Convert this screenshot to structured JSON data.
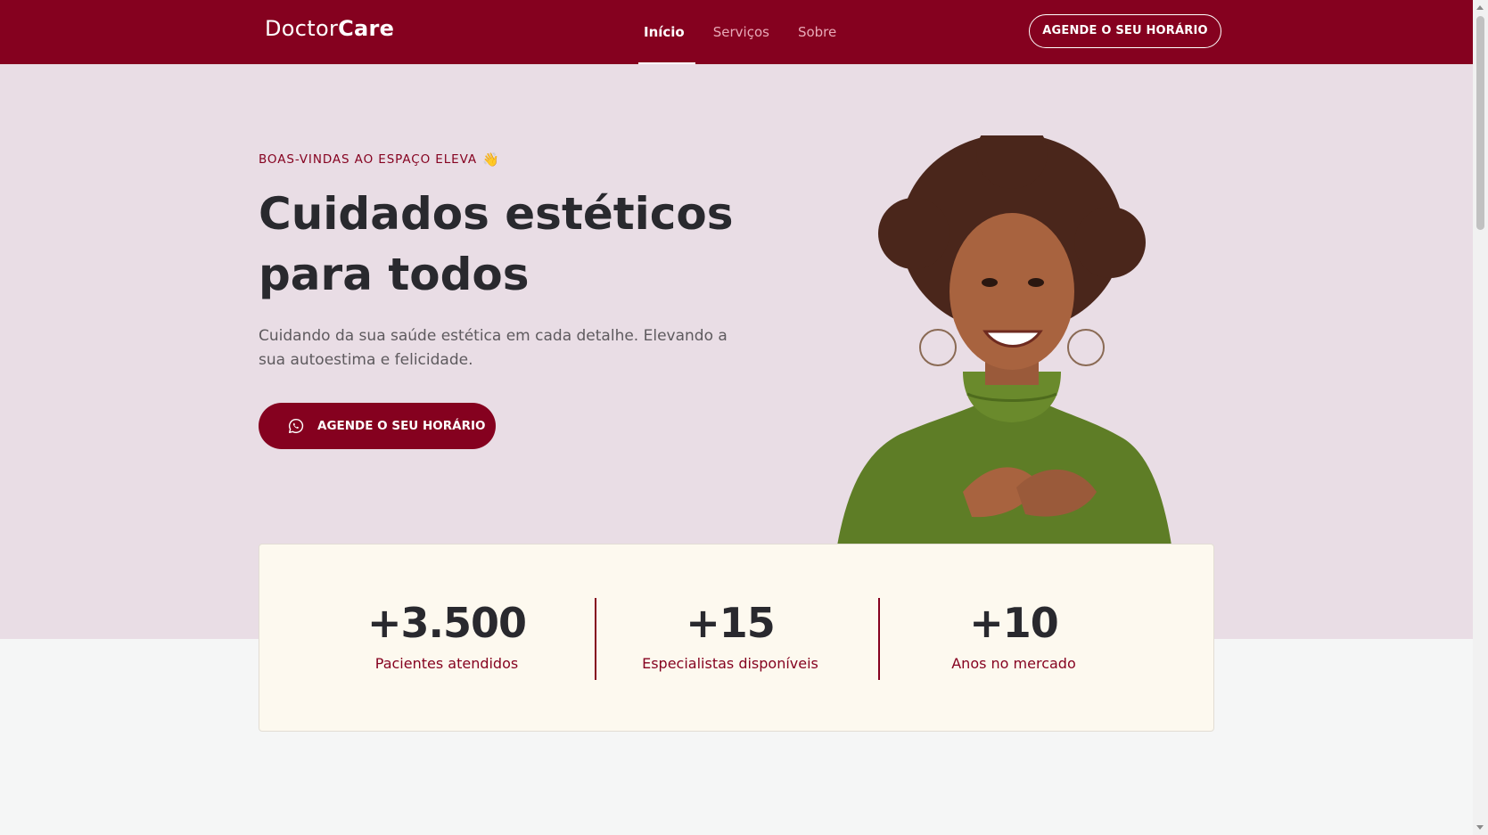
{
  "header": {
    "logo_regular": "Doctor",
    "logo_bold": "Care",
    "nav": [
      {
        "label": "Início",
        "active": true
      },
      {
        "label": "Serviços",
        "active": false
      },
      {
        "label": "Sobre",
        "active": false
      }
    ],
    "cta_label": "AGENDE O SEU HORÁRIO"
  },
  "hero": {
    "eyebrow": "BOAS-VINDAS AO ESPAÇO ELEVA",
    "eyebrow_icon": "waving-hand-icon",
    "headline_line1": "Cuidados estéticos",
    "headline_line2": "para todos",
    "subtitle": "Cuidando da sua saúde estética em cada detalhe. Elevando a sua autoestima e felicidade.",
    "cta_label": "AGENDE O SEU HORÁRIO",
    "cta_icon": "whatsapp-icon"
  },
  "stats": [
    {
      "value": "+3.500",
      "label": "Pacientes atendidos"
    },
    {
      "value": "+15",
      "label": "Especialistas disponíveis"
    },
    {
      "value": "+10",
      "label": "Anos no mercado"
    }
  ],
  "colors": {
    "brand": "#85011f",
    "hero_bg": "#e9dde5",
    "card_bg": "#fdf9ef",
    "text_dark": "#29292e"
  }
}
